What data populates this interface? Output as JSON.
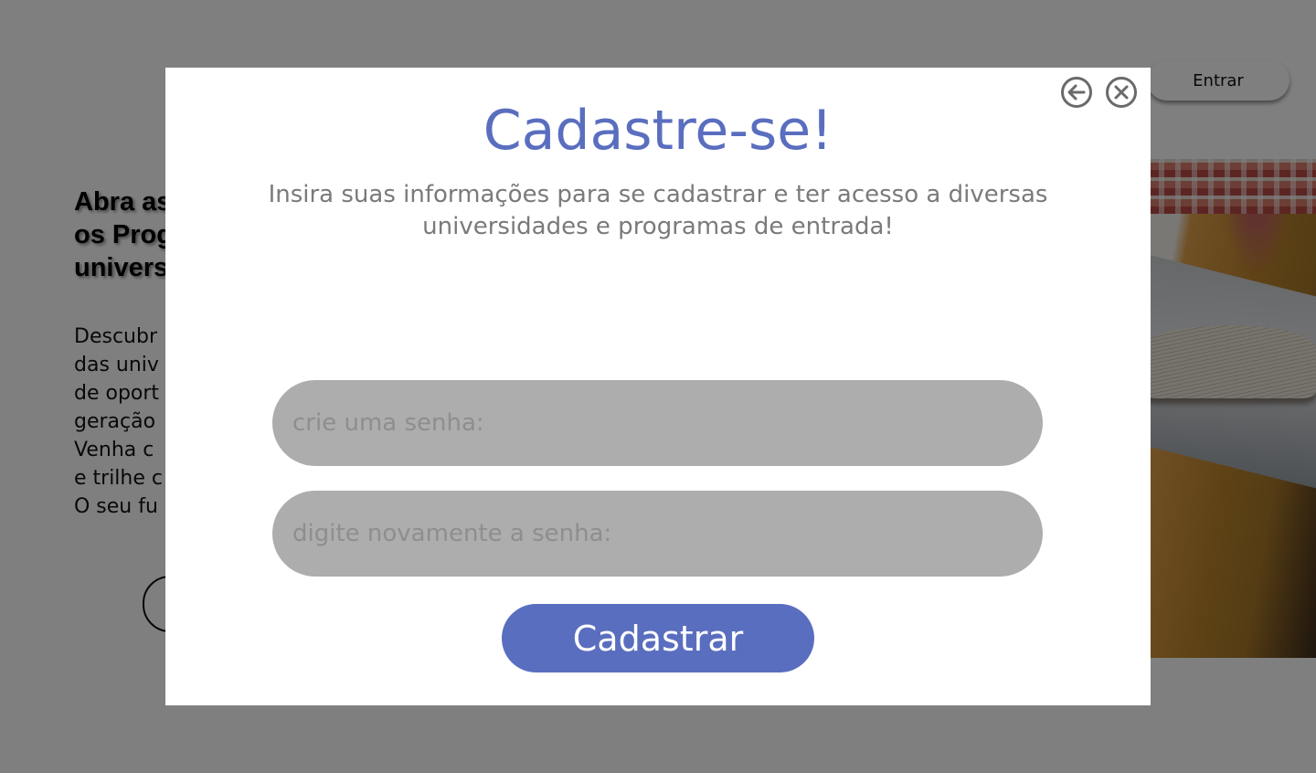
{
  "background": {
    "headline": "Abra as\nos Prog\nunivers",
    "description": "Descubr\ndas univ\nde oport\ngeração\nVenha c\ne trilhe c\nO seu fu",
    "login_button": "Entrar"
  },
  "modal": {
    "title": "Cadastre-se!",
    "subtitle": "Insira suas informações para se cadastrar e ter acesso a diversas universidades e programas de entrada!",
    "password_placeholder": "crie uma senha:",
    "confirm_placeholder": "digite novamente a senha:",
    "submit_label": "Cadastrar",
    "icons": {
      "back": "arrow-left-circle-icon",
      "close": "close-circle-icon"
    }
  },
  "colors": {
    "accent": "#5a6ebf",
    "input_bg": "#adadad",
    "overlay": "#808080",
    "subtitle_text": "#7a7a7a"
  }
}
